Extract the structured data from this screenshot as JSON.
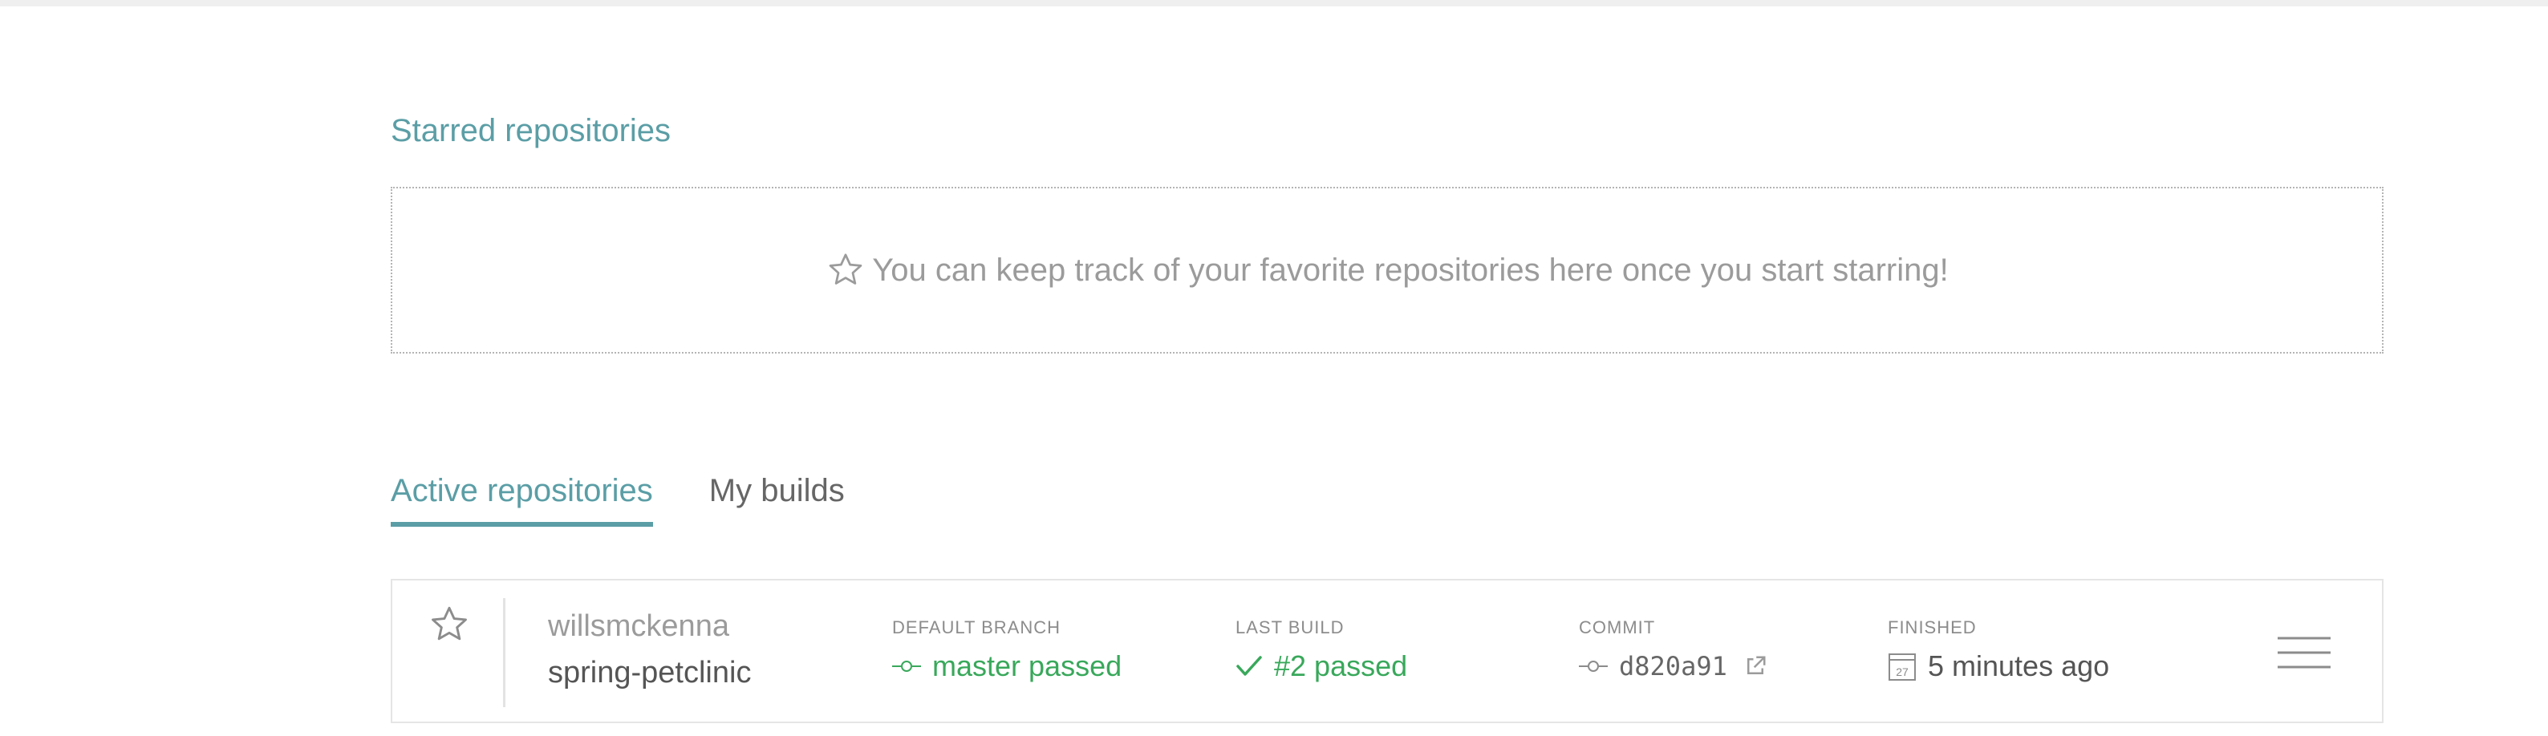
{
  "starred": {
    "title": "Starred repositories",
    "empty_message": "You can keep track of your favorite repositories here once you start starring!"
  },
  "tabs": [
    {
      "label": "Active repositories",
      "active": true
    },
    {
      "label": "My builds",
      "active": false
    }
  ],
  "repo": {
    "owner": "willsmckenna",
    "name": "spring-petclinic",
    "default_branch_label": "DEFAULT BRANCH",
    "default_branch_value": "master passed",
    "last_build_label": "LAST BUILD",
    "last_build_value": "#2 passed",
    "commit_label": "COMMIT",
    "commit_value": "d820a91",
    "finished_label": "FINISHED",
    "finished_value": "5 minutes ago",
    "calendar_day": "27"
  },
  "colors": {
    "accent": "#5b9ea6",
    "passed": "#39a85b",
    "muted": "#9b9b9b"
  },
  "icons": [
    "star-outline-icon",
    "branch-icon",
    "check-icon",
    "commit-icon",
    "external-link-icon",
    "calendar-icon",
    "hamburger-menu-icon"
  ]
}
